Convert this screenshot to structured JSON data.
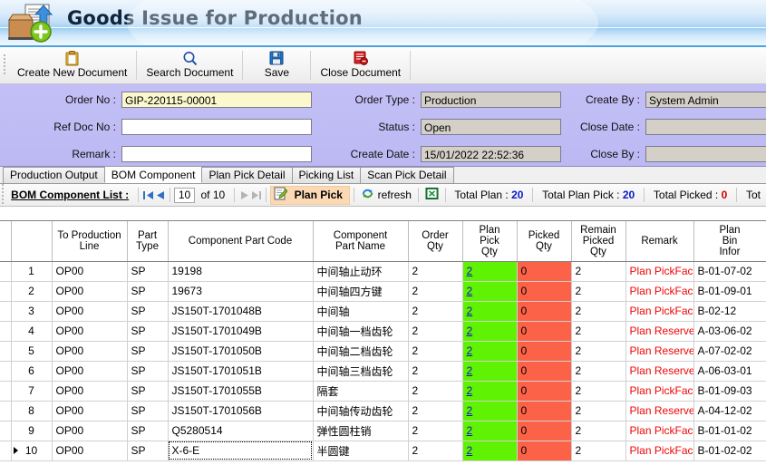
{
  "window": {
    "title": "Goods Issue for Production",
    "icon": "document-upload-box-icon"
  },
  "toolbar": {
    "buttons": [
      {
        "label": "Create New Document",
        "icon": "clipboard-icon"
      },
      {
        "label": "Search Document",
        "icon": "magnifier-icon"
      },
      {
        "label": "Save",
        "icon": "floppy-disk-icon"
      },
      {
        "label": "Close Document",
        "icon": "close-document-icon"
      }
    ]
  },
  "form": {
    "left": [
      {
        "label": "Order No :",
        "value": "GIP-220115-00001",
        "style": "highlight"
      },
      {
        "label": "Ref Doc No :",
        "value": "",
        "style": "editable"
      },
      {
        "label": "Remark :",
        "value": "",
        "style": "editable"
      }
    ],
    "middle": [
      {
        "label": "Order Type :",
        "value": "Production",
        "style": "readonly"
      },
      {
        "label": "Status :",
        "value": "Open",
        "style": "readonly"
      },
      {
        "label": "Create Date :",
        "value": "15/01/2022 22:52:36",
        "style": "readonly"
      }
    ],
    "right": [
      {
        "label": "Create By :",
        "value": "System Admin",
        "style": "readonly"
      },
      {
        "label": "Close Date :",
        "value": "",
        "style": "readonly"
      },
      {
        "label": "Close By :",
        "value": "",
        "style": "readonly"
      }
    ]
  },
  "tabs": [
    {
      "label": "Production Output",
      "active": false
    },
    {
      "label": "BOM Component",
      "active": true
    },
    {
      "label": "Plan Pick Detail",
      "active": false
    },
    {
      "label": "Picking List",
      "active": false
    },
    {
      "label": "Scan Pick Detail",
      "active": false
    }
  ],
  "gridbar": {
    "title": "BOM Component List :",
    "first_icon": "first-page-icon",
    "prev_icon": "previous-page-icon",
    "next_icon": "next-page-icon",
    "last_icon": "last-page-icon",
    "page_value": "10",
    "of_label": "of 10",
    "plan_pick": {
      "label": "Plan Pick",
      "icon": "edit-pencil-icon"
    },
    "refresh": {
      "label": "refresh",
      "icon": "refresh-icon"
    },
    "excel": {
      "icon": "excel-export-icon"
    },
    "stats": [
      {
        "label": "Total Plan :",
        "value": "20",
        "color": "blue"
      },
      {
        "label": "Total Plan Pick :",
        "value": "20",
        "color": "blue"
      },
      {
        "label": "Total Picked :",
        "value": "0",
        "color": "red"
      },
      {
        "label": "Tot",
        "value": "",
        "color": "blue"
      }
    ]
  },
  "grid": {
    "columns": [
      "",
      "To Production\nLine",
      "Part\nType",
      "Component Part Code",
      "Component\nPart Name",
      "Order\nQty",
      "Plan\nPick\nQty",
      "Picked\nQty",
      "Remain\nPicked\nQty",
      "Remark",
      "Plan\nBin\nInfor"
    ],
    "rows": [
      {
        "n": "1",
        "line": "OP00",
        "type": "SP",
        "code": "19198",
        "name": "中间轴止动环",
        "order": "2",
        "plan": "2",
        "picked": "0",
        "remain": "2",
        "remark": "Plan PickFace",
        "bin": "B-01-07-02",
        "selected": false
      },
      {
        "n": "2",
        "line": "OP00",
        "type": "SP",
        "code": "19673",
        "name": "中间轴四方键",
        "order": "2",
        "plan": "2",
        "picked": "0",
        "remain": "2",
        "remark": "Plan PickFace",
        "bin": "B-01-09-01",
        "selected": false
      },
      {
        "n": "3",
        "line": "OP00",
        "type": "SP",
        "code": "JS150T-1701048B",
        "name": "中间轴",
        "order": "2",
        "plan": "2",
        "picked": "0",
        "remain": "2",
        "remark": "Plan PickFace",
        "bin": "B-02-12",
        "selected": false
      },
      {
        "n": "4",
        "line": "OP00",
        "type": "SP",
        "code": "JS150T-1701049B",
        "name": "中间轴一档齿轮",
        "order": "2",
        "plan": "2",
        "picked": "0",
        "remain": "2",
        "remark": "Plan Reserve",
        "bin": "A-03-06-02",
        "selected": false
      },
      {
        "n": "5",
        "line": "OP00",
        "type": "SP",
        "code": "JS150T-1701050B",
        "name": "中间轴二档齿轮",
        "order": "2",
        "plan": "2",
        "picked": "0",
        "remain": "2",
        "remark": "Plan Reserve",
        "bin": "A-07-02-02",
        "selected": false
      },
      {
        "n": "6",
        "line": "OP00",
        "type": "SP",
        "code": "JS150T-1701051B",
        "name": "中间轴三档齿轮",
        "order": "2",
        "plan": "2",
        "picked": "0",
        "remain": "2",
        "remark": "Plan Reserve",
        "bin": "A-06-03-01",
        "selected": false
      },
      {
        "n": "7",
        "line": "OP00",
        "type": "SP",
        "code": "JS150T-1701055B",
        "name": "隔套",
        "order": "2",
        "plan": "2",
        "picked": "0",
        "remain": "2",
        "remark": "Plan PickFace",
        "bin": "B-01-09-03",
        "selected": false
      },
      {
        "n": "8",
        "line": "OP00",
        "type": "SP",
        "code": "JS150T-1701056B",
        "name": "中间轴传动齿轮",
        "order": "2",
        "plan": "2",
        "picked": "0",
        "remain": "2",
        "remark": "Plan Reserve",
        "bin": "A-04-12-02",
        "selected": false
      },
      {
        "n": "9",
        "line": "OP00",
        "type": "SP",
        "code": "Q5280514",
        "name": "弹性圆柱销",
        "order": "2",
        "plan": "2",
        "picked": "0",
        "remain": "2",
        "remark": "Plan PickFace",
        "bin": "B-01-01-02",
        "selected": false
      },
      {
        "n": "10",
        "line": "OP00",
        "type": "SP",
        "code": "X-6-E",
        "name": "半圆键",
        "order": "2",
        "plan": "2",
        "picked": "0",
        "remain": "2",
        "remark": "Plan PickFace",
        "bin": "B-01-02-02",
        "selected": true
      }
    ]
  },
  "colors": {
    "form_panel": "#bdb9f3",
    "plan_qty_cell": "#5ff202",
    "picked_qty_cell": "#fc6248",
    "remark_text": "#f00505",
    "link": "#1313c8",
    "highlight_field": "#fbf8cd"
  }
}
